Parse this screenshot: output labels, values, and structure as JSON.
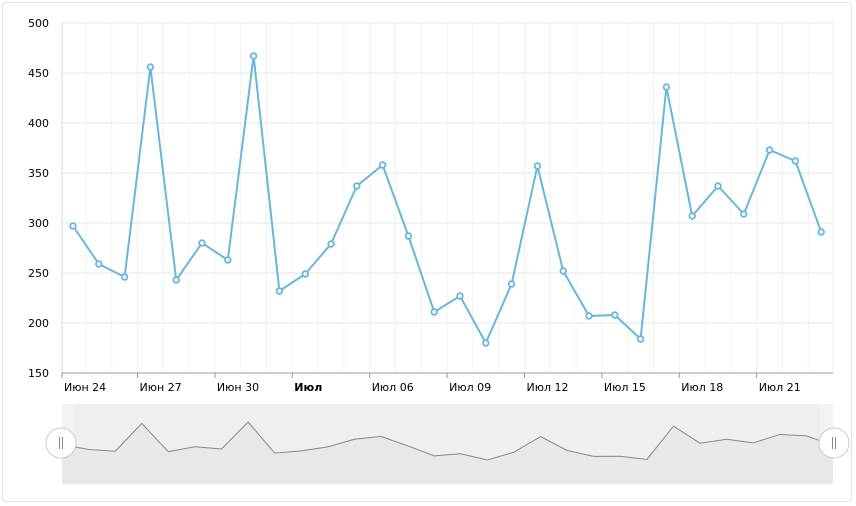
{
  "chart_data": {
    "type": "line",
    "title": "",
    "xlabel": "",
    "ylabel": "",
    "ylim": [
      150,
      500
    ],
    "y_ticks": [
      "150",
      "200",
      "250",
      "300",
      "350",
      "400",
      "450",
      "500"
    ],
    "x_tick_labels": [
      {
        "label": "Июн 24",
        "bold": false
      },
      {
        "label": "Июн 27",
        "bold": false
      },
      {
        "label": "Июн 30",
        "bold": false
      },
      {
        "label": "Июл",
        "bold": true
      },
      {
        "label": "Июл 06",
        "bold": false
      },
      {
        "label": "Июл 09",
        "bold": false
      },
      {
        "label": "Июл 12",
        "bold": false
      },
      {
        "label": "Июл 15",
        "bold": false
      },
      {
        "label": "Июл 18",
        "bold": false
      },
      {
        "label": "Июл 21",
        "bold": false
      }
    ],
    "x": [
      "2013-06-24",
      "2013-06-25",
      "2013-06-26",
      "2013-06-27",
      "2013-06-28",
      "2013-06-29",
      "2013-06-30",
      "2013-07-01",
      "2013-07-02",
      "2013-07-03",
      "2013-07-04",
      "2013-07-05",
      "2013-07-06",
      "2013-07-07",
      "2013-07-08",
      "2013-07-09",
      "2013-07-10",
      "2013-07-11",
      "2013-07-12",
      "2013-07-13",
      "2013-07-14",
      "2013-07-15",
      "2013-07-16",
      "2013-07-17",
      "2013-07-18",
      "2013-07-19",
      "2013-07-20",
      "2013-07-21",
      "2013-07-22",
      "2013-07-23"
    ],
    "series": [
      {
        "values": [
          297,
          259,
          246,
          456,
          243,
          280,
          263,
          467,
          232,
          249,
          279,
          337,
          358,
          287,
          211,
          227,
          180,
          239,
          357,
          252,
          207,
          208,
          184,
          436,
          307,
          337,
          309,
          373,
          362,
          291
        ],
        "color": "#67b7dc"
      }
    ],
    "grid": true,
    "scrollbar": {
      "visible": true,
      "range": [
        0,
        1
      ]
    }
  },
  "icons": {
    "scroll_handle_left": "grip-lines-icon",
    "scroll_handle_right": "grip-lines-icon"
  }
}
